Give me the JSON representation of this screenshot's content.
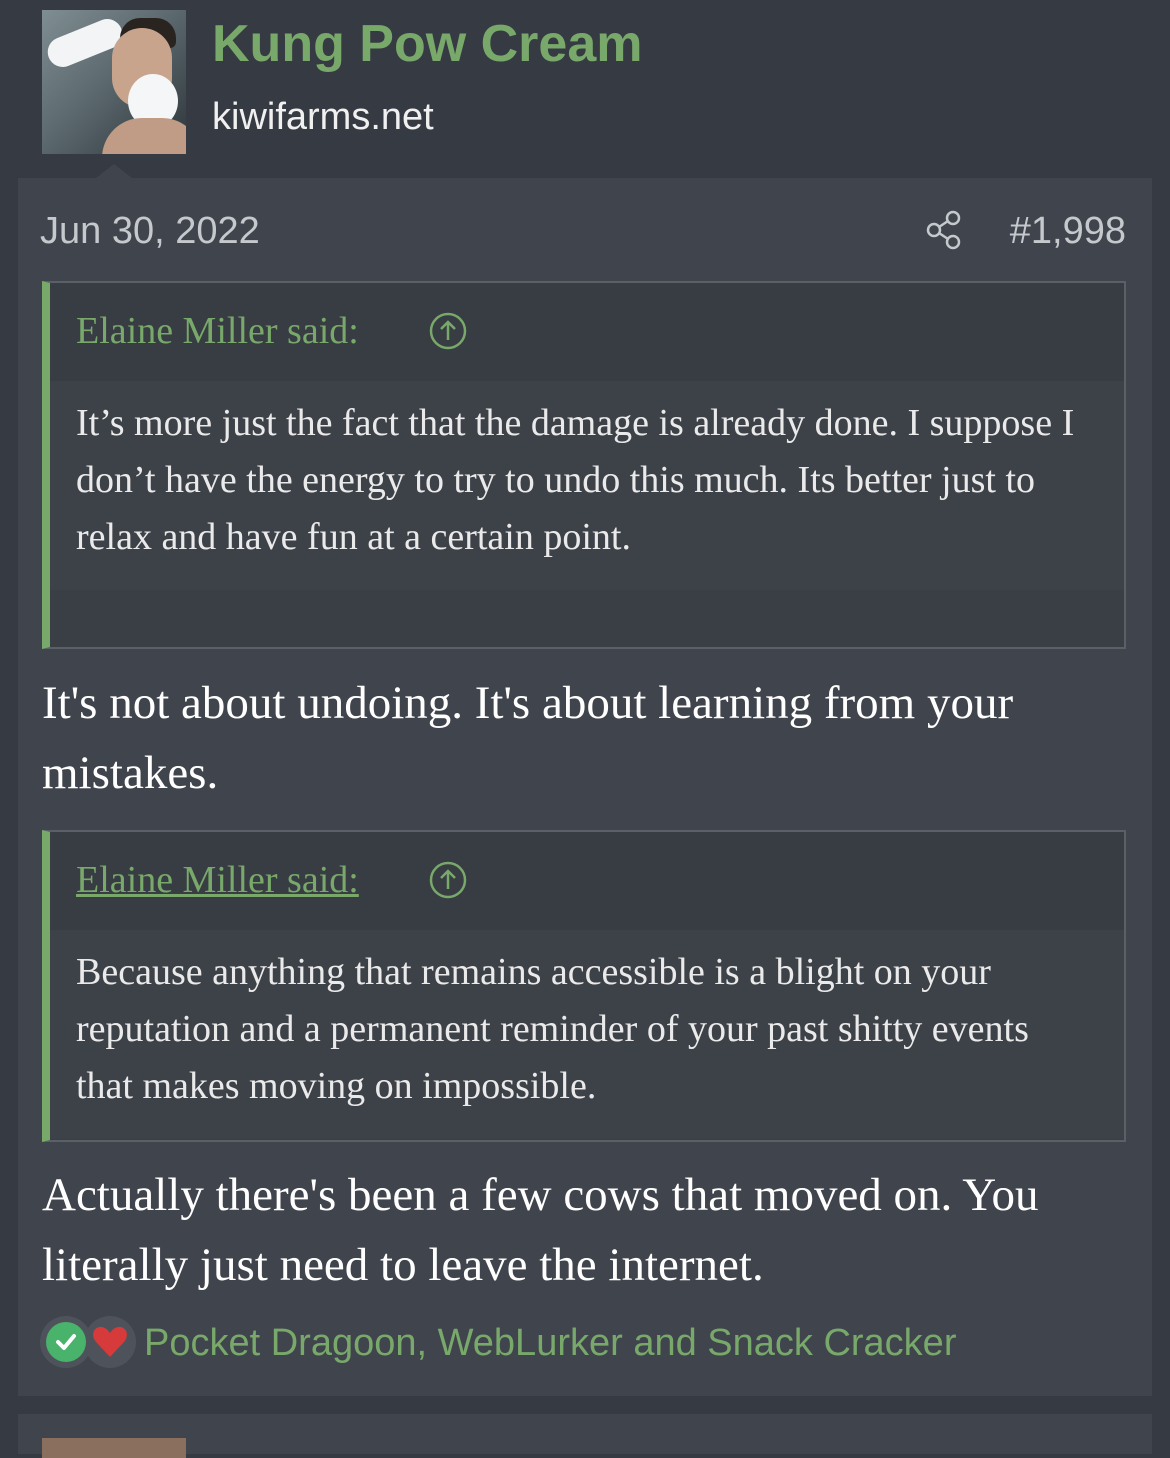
{
  "author": {
    "name": "Kung Pow Cream",
    "site": "kiwifarms.net",
    "avatar_icon": "avatar-image"
  },
  "post": {
    "date": "Jun 30, 2022",
    "number": "#1,998",
    "share_icon": "share-icon"
  },
  "quotes": [
    {
      "attribution": "Elaine Miller said:",
      "text": "It’s more just the fact that the damage is already done. I suppose I don’t have the energy to try to undo this much. Its better just to relax and have fun at a certain point."
    },
    {
      "attribution": "Elaine Miller said:",
      "text": "Because anything that remains accessible is a blight on your reputation and a permanent reminder of your past shitty events that makes moving on impossible."
    }
  ],
  "replies": [
    "It's not about undoing. It's about learning from your mistakes.",
    "Actually there's been a few cows that moved on. You literally just need to leave the internet."
  ],
  "reactions": {
    "icons": [
      "check-reaction-icon",
      "heart-reaction-icon"
    ],
    "users_text": "Pocket Dragoon, WebLurker and Snack Cracker"
  },
  "colors": {
    "accent": "#78a86a",
    "background": "#363a42",
    "post_bg": "#40444c"
  }
}
